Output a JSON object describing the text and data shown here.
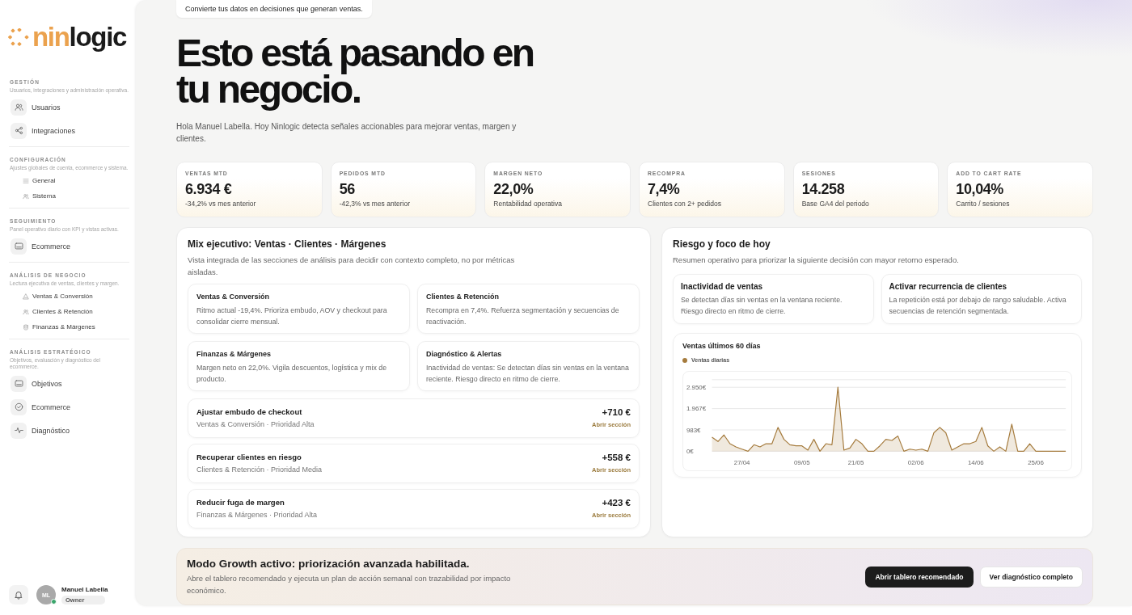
{
  "sidebar": {
    "logo": {
      "accent": "nin",
      "rest": "logic"
    },
    "sections": [
      {
        "title": "GESTIÓN",
        "description": "Usuarios, integraciones y administración operativa.",
        "items": [
          {
            "label": "Usuarios",
            "kind": "tile",
            "selected": false
          },
          {
            "label": "Integraciones",
            "kind": "tile",
            "selected": false
          }
        ]
      },
      {
        "title": "CONFIGURACIÓN",
        "description": "Ajustes globales de cuenta, ecommerce y sistema.",
        "items": [
          {
            "label": "General",
            "kind": "sub",
            "selected": false
          },
          {
            "label": "Sistema",
            "kind": "sub",
            "selected": false
          }
        ]
      },
      {
        "title": "SEGUIMIENTO",
        "description": "Panel operativo diario con KPI y vistas activas.",
        "items": [
          {
            "label": "Ecommerce",
            "kind": "tile",
            "selected": false
          }
        ]
      },
      {
        "title": "ANÁLISIS DE NEGOCIO",
        "description": "Lectura ejecutiva de ventas, clientes y margen.",
        "items": [
          {
            "label": "Ventas & Conversión",
            "kind": "sub",
            "selected": false
          },
          {
            "label": "Clientes & Retención",
            "kind": "sub",
            "selected": false
          },
          {
            "label": "Finanzas & Márgenes",
            "kind": "sub",
            "selected": false
          }
        ]
      },
      {
        "title": "ANÁLISIS ESTRATÉGICO",
        "description": "Objetivos, evaluación y diagnóstico del ecommerce.",
        "items": [
          {
            "label": "Objetivos",
            "kind": "tile",
            "selected": false
          },
          {
            "label": "Ecommerce",
            "kind": "tile",
            "selected": false
          },
          {
            "label": "Diagnóstico",
            "kind": "tile",
            "selected": false
          }
        ]
      }
    ],
    "user": {
      "initials": "ML",
      "name": "Manuel Labella",
      "role": "Owner",
      "online": true
    }
  },
  "header": {
    "tagline": "Convierte tus datos en decisiones que generan ventas.",
    "title": "Esto está pasando en tu negocio.",
    "intro": "Hola Manuel Labella. Hoy Ninlogic detecta señales accionables para mejorar ventas, margen y clientes."
  },
  "kpis": [
    {
      "label": "VENTAS MTD",
      "value": "6.934 €",
      "note": "-34,2% vs mes anterior"
    },
    {
      "label": "PEDIDOS MTD",
      "value": "56",
      "note": "-42,3% vs mes anterior"
    },
    {
      "label": "MARGEN NETO",
      "value": "22,0%",
      "note": "Rentabilidad operativa"
    },
    {
      "label": "RECOMPRA",
      "value": "7,4%",
      "note": "Clientes con 2+ pedidos"
    },
    {
      "label": "SESIONES",
      "value": "14.258",
      "note": "Base GA4 del periodo"
    },
    {
      "label": "ADD TO CART RATE",
      "value": "10,04%",
      "note": "Carrito / sesiones"
    }
  ],
  "mix_panel": {
    "title": "Mix ejecutivo: Ventas · Clientes · Márgenes",
    "description": "Vista integrada de las secciones de análisis para decidir con contexto completo, no por métricas aisladas.",
    "cards": [
      {
        "title": "Ventas & Conversión",
        "text": "Ritmo actual -19,4%. Prioriza embudo, AOV y checkout para consolidar cierre mensual."
      },
      {
        "title": "Clientes & Retención",
        "text": "Recompra en 7,4%. Refuerza segmentación y secuencias de reactivación."
      },
      {
        "title": "Finanzas & Márgenes",
        "text": "Margen neto en 22,0%. Vigila descuentos, logística y mix de producto."
      },
      {
        "title": "Diagnóstico & Alertas",
        "text": "Inactividad de ventas: Se detectan días sin ventas en la ventana reciente. Riesgo directo en ritmo de cierre."
      }
    ],
    "actions": [
      {
        "title": "Ajustar embudo de checkout",
        "meta": "Ventas & Conversión · Prioridad Alta",
        "impact": "+710 €",
        "link": "Abrir sección"
      },
      {
        "title": "Recuperar clientes en riesgo",
        "meta": "Clientes & Retención · Prioridad Media",
        "impact": "+558 €",
        "link": "Abrir sección"
      },
      {
        "title": "Reducir fuga de margen",
        "meta": "Finanzas & Márgenes · Prioridad Alta",
        "impact": "+423 €",
        "link": "Abrir sección"
      }
    ]
  },
  "risk_panel": {
    "title": "Riesgo y foco de hoy",
    "description": "Resumen operativo para priorizar la siguiente decisión con mayor retorno esperado.",
    "alerts": [
      {
        "title": "Inactividad de ventas",
        "text": "Se detectan días sin ventas en la ventana reciente. Riesgo directo en ritmo de cierre."
      },
      {
        "title": "Activar recurrencia de clientes",
        "text": "La repetición está por debajo de rango saludable. Activa secuencias de retención segmentada."
      }
    ],
    "sales_chart": {
      "chart_data": {
        "type": "area",
        "title": "Ventas últimos 60 días",
        "categories": [
          null,
          null,
          null,
          null,
          null,
          "27/04",
          null,
          null,
          null,
          null,
          null,
          null,
          null,
          null,
          null,
          "09/05",
          null,
          null,
          null,
          null,
          null,
          null,
          null,
          null,
          "21/05",
          null,
          null,
          null,
          null,
          null,
          null,
          null,
          null,
          null,
          "02/06",
          null,
          null,
          null,
          null,
          null,
          null,
          null,
          null,
          null,
          "14/06",
          null,
          null,
          null,
          null,
          null,
          null,
          null,
          null,
          null,
          "25/06",
          null,
          null,
          null,
          null,
          null
        ],
        "ylim": [
          0,
          3300
        ],
        "yticks": [
          {
            "value": 0,
            "label": "0€"
          },
          {
            "value": 983,
            "label": "983€"
          },
          {
            "value": 1967,
            "label": "1.967€"
          },
          {
            "value": 2950,
            "label": "2.950€"
          }
        ],
        "grid": true,
        "series": [
          {
            "name": "Ventas diarias",
            "color": "#a57b3d",
            "values": [
              650,
              450,
              750,
              350,
              200,
              100,
              0,
              300,
              200,
              350,
              350,
              1100,
              550,
              300,
              250,
              250,
              50,
              550,
              0,
              350,
              300,
              2950,
              50,
              150,
              550,
              350,
              0,
              0,
              250,
              550,
              500,
              700,
              0,
              100,
              50,
              100,
              0,
              850,
              1100,
              850,
              50,
              200,
              350,
              350,
              450,
              1100,
              250,
              0,
              200,
              0,
              1250,
              0,
              0,
              350,
              0,
              0,
              0,
              0,
              0,
              0
            ]
          }
        ]
      }
    }
  },
  "growth_banner": {
    "title": "Modo Growth activo: priorización avanzada habilitada.",
    "description": "Abre el tablero recomendado y ejecuta un plan de acción semanal con trazabilidad por impacto económico.",
    "buttons": [
      {
        "label": "Abrir tablero recomendado",
        "kind": "primary"
      },
      {
        "label": "Ver diagnóstico completo",
        "kind": "secondary"
      }
    ]
  }
}
